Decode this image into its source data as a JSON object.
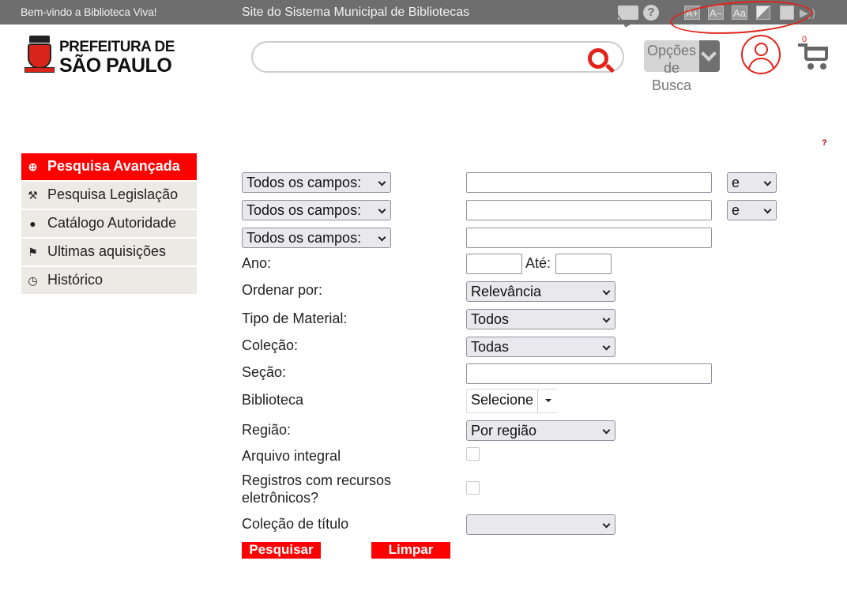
{
  "topbar": {
    "welcome": "Bem-vindo a Biblioteca Viva!",
    "site_title": "Site do Sistema Municipal de Bibliotecas",
    "font_increase": "A+",
    "font_decrease": "A–",
    "font_default": "Aa",
    "help": "?"
  },
  "header": {
    "logo_line1": "PREFEITURA DE",
    "logo_line2": "SÃO PAULO",
    "search_placeholder": "",
    "search_options_label": "Opções de Busca",
    "cart_count": "0"
  },
  "help_mark": "?",
  "sidebar": {
    "items": [
      {
        "label": "Pesquisa Avançada",
        "icon": "search-plus-icon",
        "glyph": "⊕"
      },
      {
        "label": "Pesquisa Legislação",
        "icon": "gavel-icon",
        "glyph": "⚒"
      },
      {
        "label": "Catálogo Autoridade",
        "icon": "user-icon",
        "glyph": "●"
      },
      {
        "label": "Ultimas aquisições",
        "icon": "flag-icon",
        "glyph": "⚑"
      },
      {
        "label": "Histórico",
        "icon": "clock-icon",
        "glyph": "◷"
      }
    ]
  },
  "form": {
    "field_select": [
      "Todos os campos:",
      "Todos os campos:",
      "Todos os campos:"
    ],
    "operator": [
      "e",
      "e"
    ],
    "ano_label": "Ano:",
    "ate_label": "Até:",
    "ordenar_label": "Ordenar por:",
    "ordenar_value": "Relevância",
    "tipo_label": "Tipo de Material:",
    "tipo_value": "Todos",
    "colecao_label": "Coleção:",
    "colecao_value": "Todas",
    "secao_label": "Seção:",
    "biblioteca_label": "Biblioteca",
    "biblioteca_value": "Selecione",
    "regiao_label": "Região:",
    "regiao_value": "Por região",
    "arquivo_label": "Arquivo integral",
    "registros_label_1": "Registros com recursos",
    "registros_label_2": "eletrônicos?",
    "colecao_titulo_label": "Coleção de título",
    "colecao_titulo_value": "",
    "search_button": "Pesquisar",
    "clear_button": "Limpar"
  },
  "colors": {
    "accent": "#ff0000",
    "topbar": "#6e6e6e",
    "sidebar_bg": "#eceae4"
  }
}
